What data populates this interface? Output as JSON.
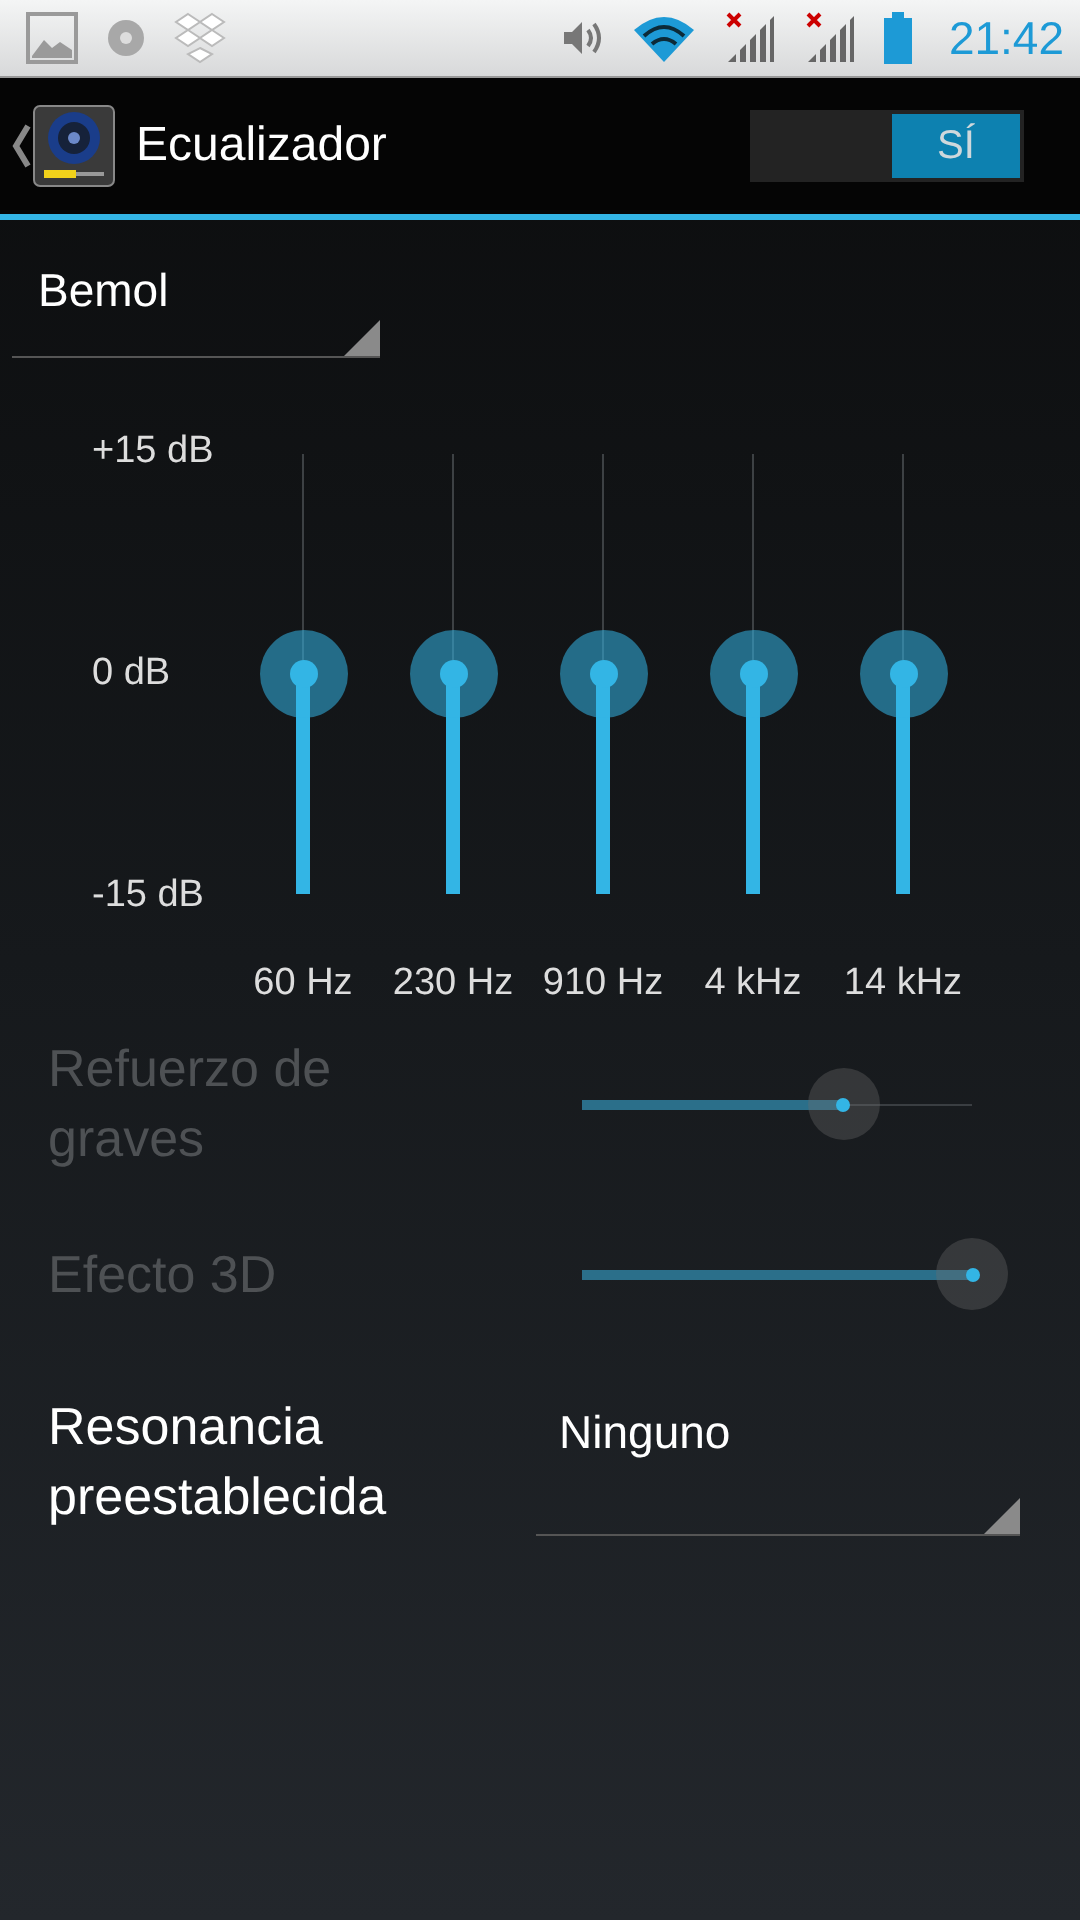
{
  "status_bar": {
    "time": "21:42"
  },
  "action_bar": {
    "title": "Ecualizador",
    "switch": {
      "label": "SÍ",
      "on": true
    }
  },
  "preset": {
    "value": "Bemol"
  },
  "equalizer": {
    "db_labels": [
      "+15 dB",
      "0 dB",
      "-15 dB"
    ],
    "bands": [
      {
        "label": "60 Hz",
        "level": 0.5
      },
      {
        "label": "230 Hz",
        "level": 0.5
      },
      {
        "label": "910 Hz",
        "level": 0.5
      },
      {
        "label": "4 kHz",
        "level": 0.5
      },
      {
        "label": "14 kHz",
        "level": 0.5
      }
    ]
  },
  "settings": [
    {
      "kind": "slider",
      "label": "Refuerzo de graves",
      "disabled": true,
      "level": 0.67
    },
    {
      "kind": "slider",
      "label": "Efecto 3D",
      "disabled": true,
      "level": 1
    },
    {
      "kind": "dropdown",
      "label": "Resonancia preestablecida",
      "value": "Ninguno"
    }
  ]
}
